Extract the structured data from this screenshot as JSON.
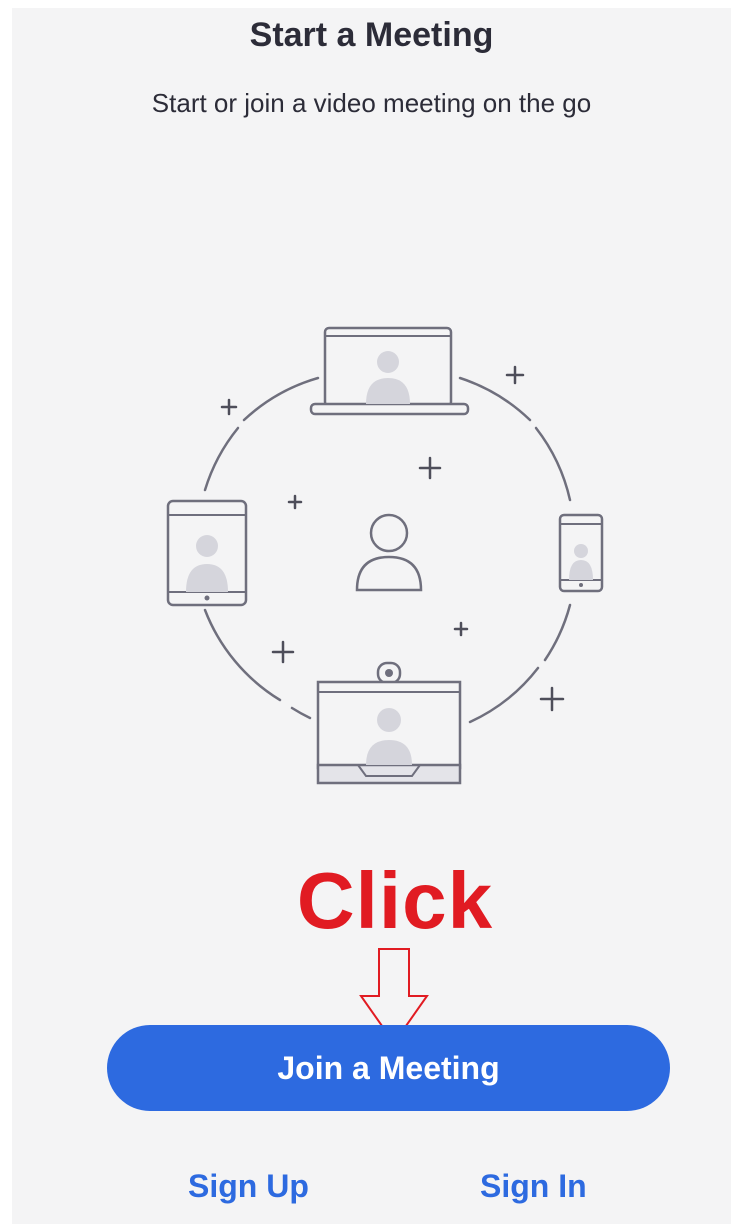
{
  "header": {
    "title": "Start a Meeting",
    "subtitle": "Start or join a video meeting on the go"
  },
  "illustration": {
    "icon": "video-meeting-illustration",
    "devices": [
      "laptop-icon",
      "tablet-icon",
      "phone-icon",
      "room-system-icon",
      "user-avatar-icon"
    ]
  },
  "annotation": {
    "click_label": "Click",
    "click_color": "#e11b22",
    "arrow_icon": "down-arrow-icon"
  },
  "actions": {
    "join_label": "Join a Meeting",
    "signup_label": "Sign Up",
    "signin_label": "Sign In"
  },
  "colors": {
    "accent": "#2d6ae0",
    "background": "#f4f4f5",
    "text": "#2c2c38"
  }
}
